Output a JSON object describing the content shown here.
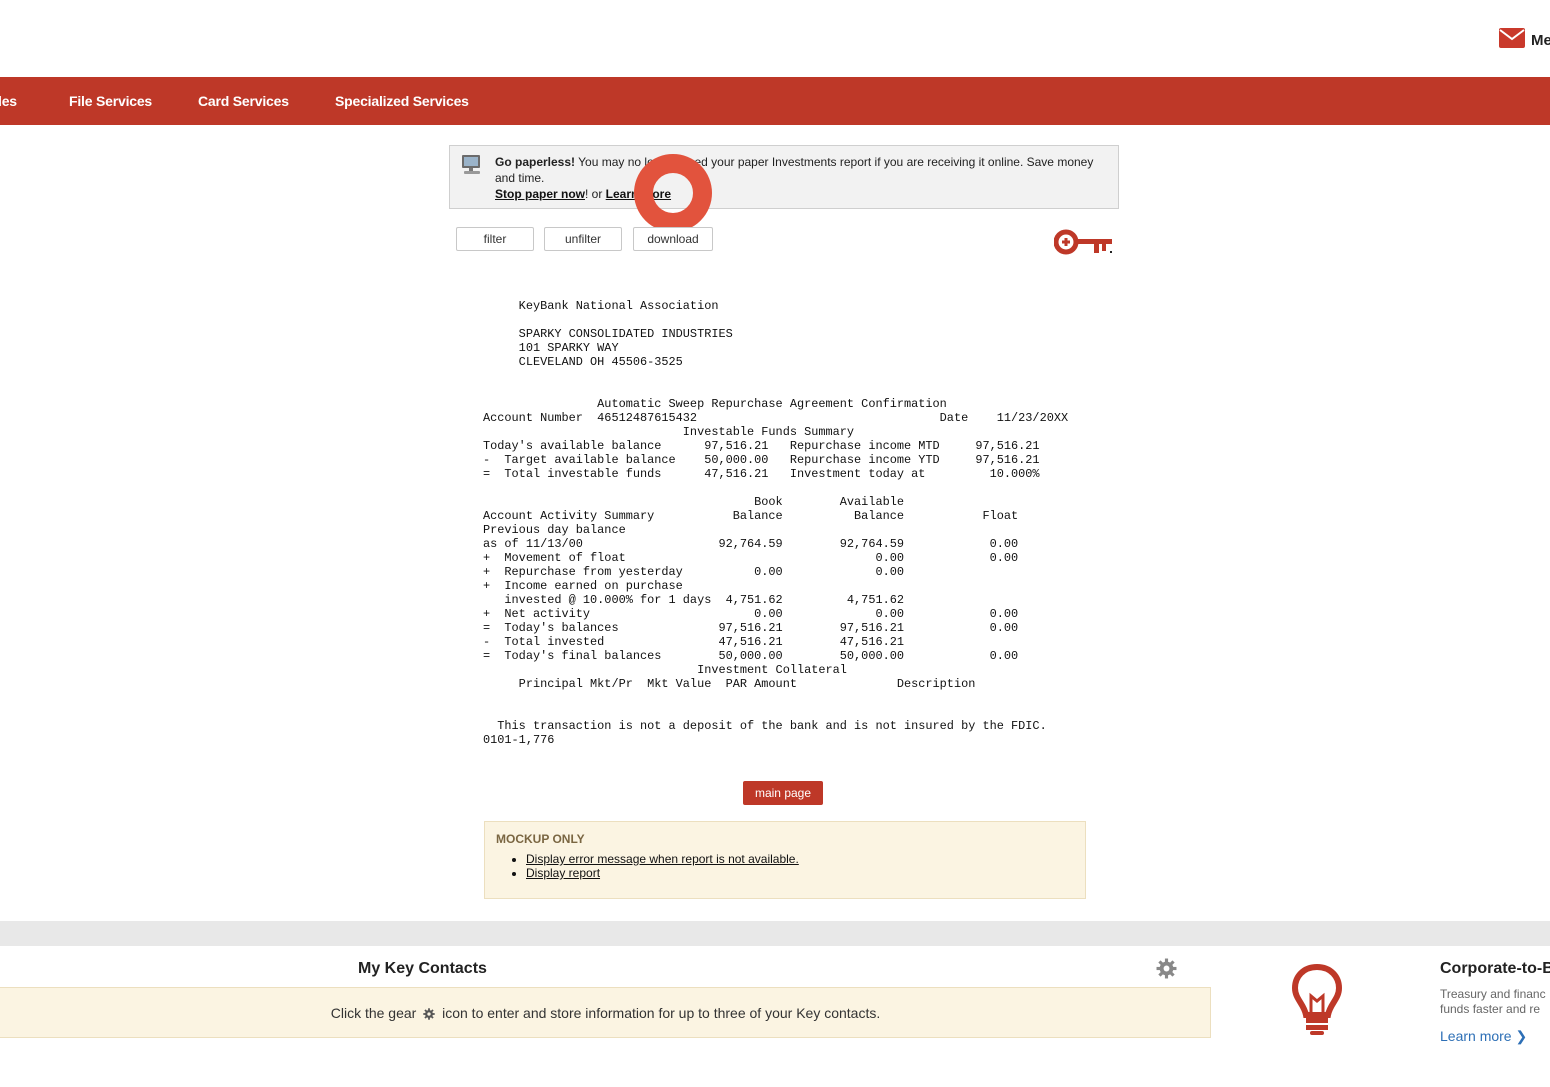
{
  "header": {
    "messages_label": "Me",
    "icon": "envelope-icon",
    "icon_color": "#c9392b"
  },
  "nav": {
    "bg_color": "#be3828",
    "items": [
      {
        "label": "les"
      },
      {
        "label": "File Services"
      },
      {
        "label": "Card Services"
      },
      {
        "label": "Specialized Services"
      }
    ]
  },
  "notice": {
    "bold_lead": "Go paperless!",
    "text": " You may no longer need your paper Investments report if you are receiving it online. Save money and time.",
    "stop_link": "Stop paper now",
    "sep": "! or ",
    "learn_link": "Learn more"
  },
  "toolbar": {
    "filter_label": "filter",
    "unfilter_label": "unfilter",
    "download_label": "download"
  },
  "report": {
    "text": "     KeyBank National Association\n\n     SPARKY CONSOLIDATED INDUSTRIES\n     101 SPARKY WAY\n     CLEVELAND OH 45506-3525\n\n\n                Automatic Sweep Repurchase Agreement Confirmation\nAccount Number  46512487615432                                  Date    11/23/20XX\n                            Investable Funds Summary\nToday's available balance      97,516.21   Repurchase income MTD     97,516.21\n-  Target available balance    50,000.00   Repurchase income YTD     97,516.21\n=  Total investable funds      47,516.21   Investment today at         10.000%\n\n                                      Book        Available\nAccount Activity Summary           Balance          Balance           Float\nPrevious day balance\nas of 11/13/00                   92,764.59        92,764.59            0.00\n+  Movement of float                                   0.00            0.00\n+  Repurchase from yesterday          0.00             0.00\n+  Income earned on purchase\n   invested @ 10.000% for 1 days  4,751.62         4,751.62\n+  Net activity                       0.00             0.00            0.00\n=  Today's balances              97,516.21        97,516.21            0.00\n-  Total invested                47,516.21        47,516.21\n=  Today's final balances        50,000.00        50,000.00            0.00\n                              Investment Collateral\n     Principal Mkt/Pr  Mkt Value  PAR Amount              Description\n\n\n  This transaction is not a deposit of the bank and is not insured by the FDIC.\n0101-1,776"
  },
  "main_page_label": "main page",
  "mockup": {
    "title": "MOCKUP ONLY",
    "items": [
      {
        "label": "Display error message when report is not available."
      },
      {
        "label": "Display report"
      }
    ]
  },
  "contacts": {
    "title": "My Key Contacts",
    "msg_before": "Click the gear ",
    "msg_after": " icon to enter and store information for up to three of your Key contacts."
  },
  "promo": {
    "title": "Corporate-to-B",
    "text": "Treasury and financ\nfunds faster and re",
    "link": "Learn more ❯"
  },
  "colors": {
    "brand_red": "#be3828",
    "marker": "#e2533d",
    "link_blue": "#2d6fb6"
  }
}
